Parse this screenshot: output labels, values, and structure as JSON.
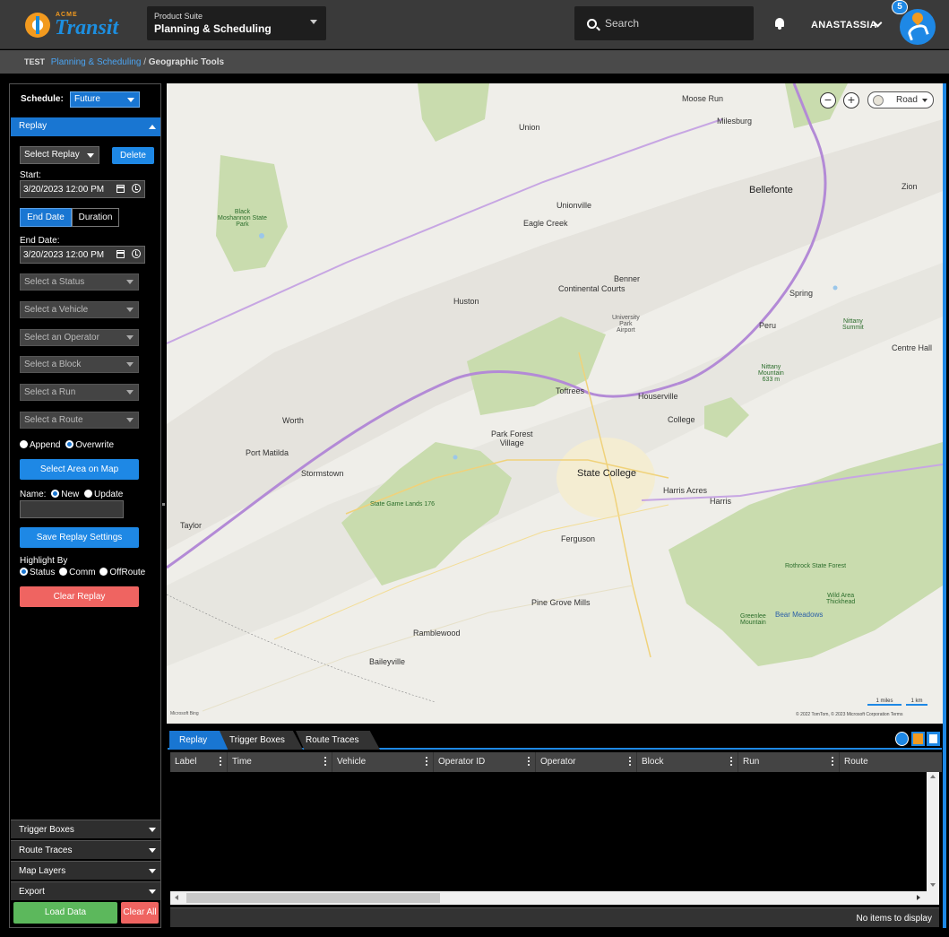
{
  "header": {
    "brand_small": "ACME",
    "brand": "Transit",
    "suite_label": "Product Suite",
    "suite_value": "Planning & Scheduling",
    "search_placeholder": "Search",
    "user_name": "ANASTASSIA",
    "app_badge": "5"
  },
  "breadcrumb": {
    "env": "TEST",
    "parent": "Planning & Scheduling",
    "separator": "/",
    "current": "Geographic Tools"
  },
  "sidebar": {
    "schedule_label": "Schedule:",
    "schedule_value": "Future",
    "replay_section": "Replay",
    "select_replay": "Select Replay",
    "delete_label": "Delete",
    "start_label": "Start:",
    "start_value": "3/20/2023 12:00 PM",
    "end_date_tab": "End Date",
    "duration_tab": "Duration",
    "end_label": "End Date:",
    "end_value": "3/20/2023 12:00 PM",
    "filters": [
      "Select a Status",
      "Select a Vehicle",
      "Select an Operator",
      "Select a Block",
      "Select a Run",
      "Select a Route"
    ],
    "append_label": "Append",
    "overwrite_label": "Overwrite",
    "select_area_label": "Select Area on Map",
    "name_label": "Name:",
    "new_label": "New",
    "update_label": "Update",
    "save_settings_label": "Save Replay Settings",
    "highlight_label": "Highlight By",
    "status_label": "Status",
    "comm_label": "Comm",
    "offroute_label": "OffRoute",
    "clear_replay_label": "Clear Replay",
    "sections": [
      "Trigger Boxes",
      "Route Traces",
      "Map Layers",
      "Export"
    ],
    "load_data_label": "Load Data",
    "clear_all_label": "Clear All"
  },
  "map": {
    "road_style": "Road",
    "places": {
      "moose_run": "Moose Run",
      "milesburg": "Milesburg",
      "union": "Union",
      "bellefonte": "Bellefonte",
      "zion": "Zion",
      "unionville": "Unionville",
      "eagle_creek": "Eagle Creek",
      "black_moshannon": "Black\nMoshannon State\nPark",
      "benner": "Benner",
      "continental_courts": "Continental Courts",
      "huston": "Huston",
      "spring": "Spring",
      "university_park_airport": "University\nPark\nAirport",
      "peru": "Peru",
      "nittany_summit": "Nittany\nSummit",
      "centre_hall": "Centre Hall",
      "nittany_mountain": "Nittany\nMountain\n633 m",
      "toftrees": "Toftrees",
      "houserville": "Houserville",
      "worth": "Worth",
      "college": "College",
      "park_forest_village": "Park Forest\nVillage",
      "port_matilda": "Port Matilda",
      "stormstown": "Stormstown",
      "state_college": "State College",
      "harris_acres": "Harris Acres",
      "harris": "Harris",
      "state_game_lands": "State Game Lands 176",
      "taylor": "Taylor",
      "ferguson": "Ferguson",
      "rothrock": "Rothrock State Forest",
      "wild_area": "Wild Area\nThickhead",
      "bear_meadows": "Bear Meadows",
      "greenlee": "Greenlee\nMountain",
      "pine_grove_mills": "Pine Grove Mills",
      "ramblewood": "Ramblewood",
      "baileyville": "Baileyville"
    },
    "scale_miles": "1 miles",
    "scale_km": "1 km",
    "attribution_left": "Microsoft Bing",
    "attribution_right": "© 2022 TomTom, © 2023 Microsoft Corporation  Terms"
  },
  "grid": {
    "tabs": [
      "Replay",
      "Trigger Boxes",
      "Route Traces"
    ],
    "columns": [
      "Label",
      "Time",
      "Vehicle",
      "Operator ID",
      "Operator",
      "Block",
      "Run",
      "Route"
    ],
    "empty_text": "No items to display"
  }
}
